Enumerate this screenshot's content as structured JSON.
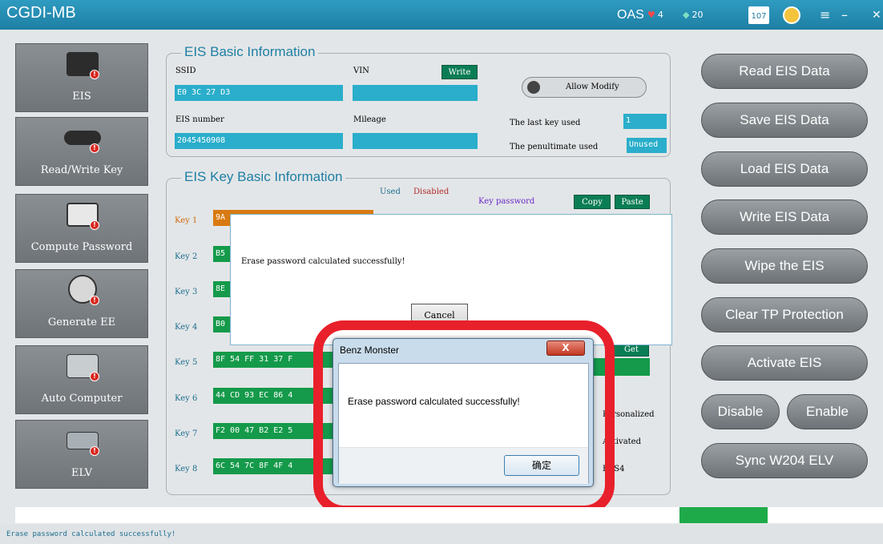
{
  "titlebar": {
    "title": "CGDI-MB",
    "oas_label": "OAS",
    "hearts": "4",
    "gems": "20",
    "calendar": "107",
    "menu_icon": "menu-icon",
    "minimize_icon": "minimize-icon",
    "close_icon": "close-icon"
  },
  "sidebar": {
    "items": [
      {
        "label": "EIS",
        "icon": "eis-icon"
      },
      {
        "label": "Read/Write Key",
        "icon": "key-icon"
      },
      {
        "label": "Compute Password",
        "icon": "computer-icon"
      },
      {
        "label": "Generate EE",
        "icon": "printer-icon"
      },
      {
        "label": "Auto Computer",
        "icon": "ecu-icon"
      },
      {
        "label": "ELV",
        "icon": "elv-icon"
      }
    ]
  },
  "eis_basic": {
    "title": "EIS Basic Information",
    "ssid_label": "SSID",
    "ssid_value": "E0 3C 27 D3",
    "vin_label": "VIN",
    "vin_value": "",
    "write_label": "Write",
    "allow_modify_label": "Allow Modify",
    "eis_number_label": "EIS number",
    "eis_number_value": "2045450908",
    "mileage_label": "Mileage",
    "mileage_value": "",
    "last_key_label": "The last key used",
    "last_key_value": "1",
    "penultimate_label": "The penultimate used",
    "penultimate_value": "Unused"
  },
  "eis_key": {
    "title": "EIS Key Basic Information",
    "used_label": "Used",
    "disabled_label": "Disabled",
    "key_password_label": "Key password",
    "copy_label": "Copy",
    "paste_label": "Paste",
    "get_label": "Get",
    "personalized_label": "Personalized",
    "activated_label": "Activated",
    "fbs4_label": "FBS4",
    "keys": [
      {
        "label": "Key 1",
        "value": "9A"
      },
      {
        "label": "Key 2",
        "value": "B5"
      },
      {
        "label": "Key 3",
        "value": "8E"
      },
      {
        "label": "Key 4",
        "value": "B0"
      },
      {
        "label": "Key 5",
        "value": "8F 54 FF 31 37 F"
      },
      {
        "label": "Key 6",
        "value": "44 CD 93 EC 86 4"
      },
      {
        "label": "Key 7",
        "value": "F2 00 47 B2 E2 5"
      },
      {
        "label": "Key 8",
        "value": "6C 54 7C 8F 4F 4"
      }
    ]
  },
  "side_buttons": {
    "read": "Read  EIS Data",
    "save": "Save EIS Data",
    "load": "Load EIS Data",
    "write": "Write EIS Data",
    "wipe": "Wipe the EIS",
    "clear_tp": "Clear TP Protection",
    "activate": "Activate EIS",
    "disable": "Disable",
    "enable": "Enable",
    "sync": "Sync W204 ELV"
  },
  "dialog_inner": {
    "message": "Erase password calculated successfully!",
    "cancel_label": "Cancel"
  },
  "dialog_msgbox": {
    "title": "Benz Monster",
    "close_label": "X",
    "message": "Erase password calculated successfully!",
    "ok_label": "确定"
  },
  "progress": {
    "fill_start_fraction": 0.78,
    "fill_end_fraction": 0.88
  },
  "status": {
    "message": "Erase password calculated successfully!"
  },
  "colors": {
    "titlebar": "#1e7fa4",
    "field_blue": "#2aaecb",
    "key_green": "#149a4a",
    "highlight_red": "#e8202b"
  }
}
